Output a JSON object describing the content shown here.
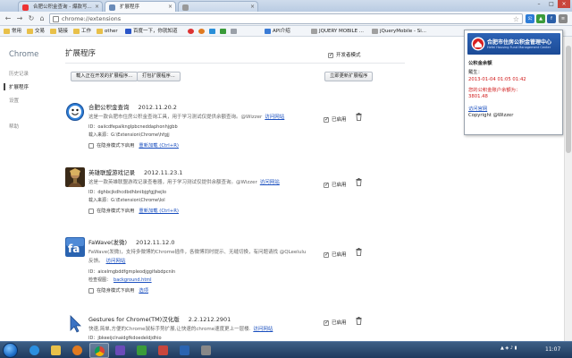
{
  "tabs": [
    {
      "title": "合肥公积金查询 - 爆款写...",
      "active": false
    },
    {
      "title": "扩展程序",
      "active": true
    },
    {
      "title": "",
      "active": false
    }
  ],
  "address_bar": {
    "url": "chrome://extensions"
  },
  "bookmarks": [
    "常用",
    "交易",
    "链接",
    "工作",
    "other",
    "百度一下，你就知道",
    "",
    "",
    "",
    "",
    "",
    "API介绍",
    "JQUERY MOBILE ...",
    "jQueryMobile - Si..."
  ],
  "sidebar": {
    "brand": "Chrome",
    "items": [
      {
        "label": "历史记录",
        "selected": false
      },
      {
        "label": "扩展程序",
        "selected": true
      },
      {
        "label": "设置",
        "selected": false
      },
      {
        "label": "帮助",
        "selected": false
      }
    ]
  },
  "main": {
    "title": "扩展程序",
    "dev_mode_label": "开发者模式",
    "dev_mode_checked": true,
    "buttons": {
      "load_unpacked": "载入正在开发的扩展程序...",
      "pack": "打包扩展程序...",
      "update": "立即更新扩展程序"
    }
  },
  "extensions": [
    {
      "name": "合肥公积金查询",
      "version": "2012.11.20.2",
      "description": "这是一款合肥市住房公积金查询工具，用于学习测试仅提供余额查询。@Wizzer",
      "desc2": "",
      "link": "访问网站",
      "id_label": "ID：",
      "id": "oaiicdfepalknglpbcneddaphonhjgbb",
      "source_label": "载入来源：",
      "source": "G:\\Extension\\Chrome\\hfgjj",
      "incognito_label": "在隐身模式下启用",
      "reload_label": "重新加载 (Ctrl+R)",
      "options_label": "",
      "enabled_label": "已启用",
      "enabled": true
    },
    {
      "name": "英雄联盟游戏记录",
      "version": "2012.11.23.1",
      "description": "这是一款英雄联盟游戏记录查看器，用于学习测试仅提供余额查询。@Wizzer",
      "desc2": "",
      "link": "访问网站",
      "id_label": "ID：",
      "id": "dghbcjkdhcdbdhbnibjgfgjjhejlo",
      "source_label": "载入来源：",
      "source": "G:\\Extension\\Chrome\\lol",
      "incognito_label": "在隐身模式下启用",
      "reload_label": "重新加载 (Ctrl+R)",
      "options_label": "",
      "enabled_label": "已启用",
      "enabled": true
    },
    {
      "name": "FaWave(发微)",
      "version": "2012.11.12.0",
      "description": "FaWave(发微)，支持多微博的Chrome插件，各微博同时提示、无缝切换，有问题请找 @QLeelulu",
      "desc2": "反馈。",
      "link": "访问网站",
      "id_label": "ID：",
      "id": "aicelmgbddfgmpleodjggifabdpcnln",
      "source_label": "检查视图：",
      "source": "background.html",
      "incognito_label": "在隐身模式下启用",
      "reload_label": "",
      "options_label": "选项",
      "enabled_label": "已启用",
      "enabled": true
    },
    {
      "name": "Gestures for Chrome(TM)汉化版",
      "version": "2.2.1212.2901",
      "description": "快速,简单,方便的Chrome鼠标手势扩展,让快速的chrome速度更上一层楼.",
      "desc2": "",
      "link": "访问网站",
      "id_label": "ID：",
      "id": "jbkeeijclnaidgfkdoedeldjdhio",
      "source_label": "",
      "source": "",
      "incognito_label": "",
      "reload_label": "",
      "options_label": "",
      "enabled_label": "已启用",
      "enabled": true
    }
  ],
  "popup": {
    "banner_title": "合肥市住房公积金管理中心",
    "banner_sub": "Hefei Housing Fund Management Center",
    "heading": "公积金余额",
    "name_label": "戴生：",
    "date_line": "2013-01-04 01:05 01:42",
    "balance_label": "您的公积金账户余额为：",
    "balance": "3801.48",
    "visit": "访问官网",
    "copyright": "Copyright @Wizzer"
  },
  "taskbar": {
    "clock": "11:07"
  },
  "colors": {
    "link": "#1a4fbf",
    "popup_red": "#d01818",
    "banner": "#1b4a96"
  }
}
